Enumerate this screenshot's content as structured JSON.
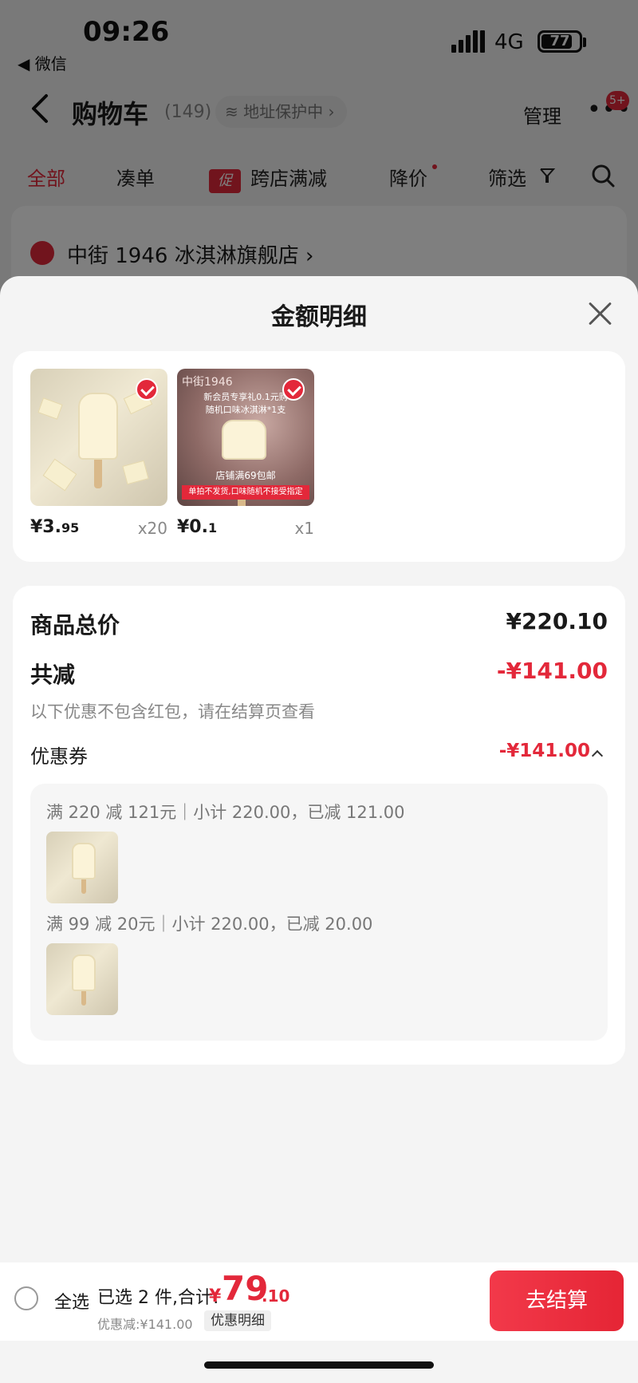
{
  "status_bar": {
    "time": "09:26",
    "back_app": "◀ 微信",
    "network": "4G",
    "battery": "77",
    "battery_level": 0.77
  },
  "navbar": {
    "title": "购物车",
    "count": "(149)",
    "address": "地址保护中",
    "manage": "管理",
    "badge": "5+"
  },
  "filters": [
    {
      "label": "全部",
      "active": true
    },
    {
      "label": "凑单",
      "active": false
    },
    {
      "label": "跨店满减",
      "tag": "促",
      "active": false
    },
    {
      "label": "降价",
      "active": false
    },
    {
      "label": "筛选",
      "active": false
    }
  ],
  "store": {
    "name": "中街 1946 冰淇淋旗舰店"
  },
  "sheet": {
    "title": "金额明细",
    "products": [
      {
        "price_int": "¥3.",
        "price_dec": "95",
        "qty": "x20"
      },
      {
        "price_int": "¥0.",
        "price_dec": "1",
        "qty": "x1",
        "thumb_logo": "中街1946",
        "thumb_line1": "新会员专享礼0.1元购",
        "thumb_line2": "随机口味冰淇淋*1支",
        "thumb_line3": "店铺满69包邮",
        "thumb_banner": "单拍不发货,口味随机不接受指定"
      }
    ],
    "summary": {
      "total_label": "商品总价",
      "total_value": "¥220.10",
      "reduce_label": "共减",
      "reduce_value": "-¥141.00",
      "note": "以下优惠不包含红包，请在结算页查看",
      "coupon_label": "优惠券",
      "coupon_value": "-¥141.00",
      "rules": [
        {
          "text": "满 220 减 121元｜小计 220.00，已减 121.00"
        },
        {
          "text": "满 99 减 20元｜小计 220.00，已减 20.00"
        }
      ]
    }
  },
  "checkout": {
    "select_all": "全选",
    "selected": "已选 2 件,合计:",
    "total_symbol": "¥",
    "total_int": "79",
    "total_dec": ".10",
    "discount": "优惠减:¥141.00",
    "detail_button": "优惠明细",
    "checkout_button": "去结算"
  },
  "colors": {
    "accent": "#e3283a",
    "sheet_bg": "#f4f4f4",
    "card_bg": "#ffffff"
  }
}
